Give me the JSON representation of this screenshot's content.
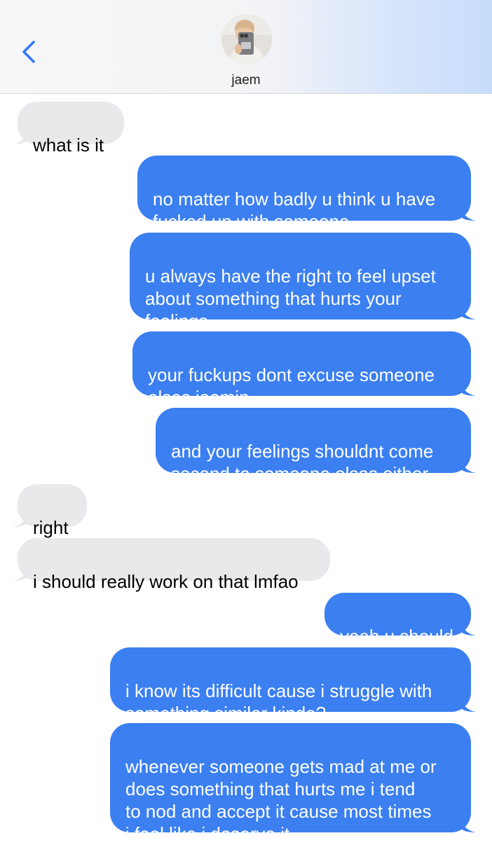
{
  "header": {
    "contact_name": "jaem"
  },
  "colors": {
    "outgoing_bubble": "#3b7ff0",
    "incoming_bubble": "#e9e9eb",
    "back_chevron": "#3478f6"
  },
  "icons": {
    "back": "chevron-left-icon",
    "avatar": "contact-photo"
  },
  "messages": [
    {
      "direction": "incoming",
      "text": "what is it"
    },
    {
      "direction": "outgoing",
      "text": "no matter how badly u think u have\nfucked up with someone"
    },
    {
      "direction": "outgoing",
      "text": "u always have the right to feel upset\nabout something that hurts your\nfeelings"
    },
    {
      "direction": "outgoing",
      "text": "your fuckups dont excuse someone\nelses jaemin"
    },
    {
      "direction": "outgoing",
      "text": "and your feelings shouldnt come\nsecond to someone elses either..."
    },
    {
      "direction": "incoming",
      "text": "right"
    },
    {
      "direction": "incoming",
      "text": "i should really work on that lmfao"
    },
    {
      "direction": "outgoing",
      "text": "yeah u should"
    },
    {
      "direction": "outgoing",
      "text": "i know its difficult cause i struggle with\nsomething similar kinda?"
    },
    {
      "direction": "outgoing",
      "text": "whenever someone gets mad at me or\ndoes something that hurts me i tend\nto nod and accept it cause most times\ni feel like i deserve it"
    }
  ]
}
